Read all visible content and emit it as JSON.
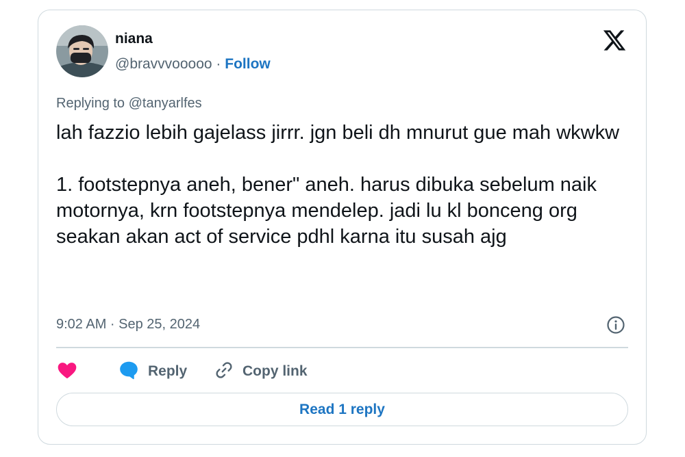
{
  "author": {
    "display_name": "niana",
    "handle": "@bravvvooooo",
    "separator": "·",
    "follow_label": "Follow"
  },
  "reply_context": {
    "prefix": "Replying to",
    "mention": "@tanyarlfes"
  },
  "tweet": {
    "line1": "lah fazzio lebih gajelass jirrr. jgn beli dh mnurut gue mah wkwkw",
    "line2": "1. footstepnya aneh, bener\" aneh. harus dibuka sebelum naik motornya, krn footstepnya mendelep. jadi lu kl bonceng org seakan akan act of service pdhl karna itu susah ajg"
  },
  "timestamp": "9:02 AM · Sep 25, 2024",
  "actions": {
    "reply_label": "Reply",
    "copy_link_label": "Copy link"
  },
  "read_replies_label": "Read 1 reply",
  "icons": {
    "logo": "x-logo-icon",
    "info": "info-icon",
    "like": "heart-icon",
    "reply": "speech-bubble-icon",
    "copy": "link-icon"
  },
  "colors": {
    "text": "#0f1419",
    "secondary": "#536471",
    "link": "#1d75c2",
    "heart": "#f91880",
    "reply_bubble": "#1d9bf0",
    "border": "#cfd9de"
  }
}
